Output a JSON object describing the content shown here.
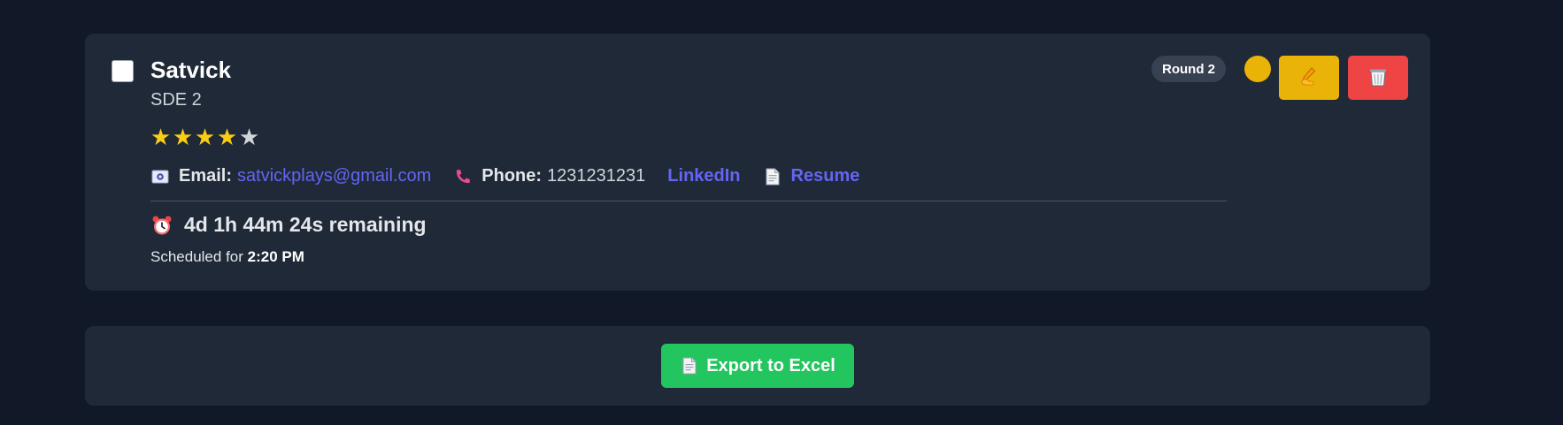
{
  "candidate": {
    "name": "Satvick",
    "role": "SDE 2",
    "rating": 4,
    "rating_max": 5,
    "email_label": "Email:",
    "email": "satvickplays@gmail.com",
    "phone_label": "Phone:",
    "phone": "1231231231",
    "linkedin_label": "LinkedIn",
    "resume_label": "Resume",
    "time_remaining": "4d 1h 44m 24s remaining",
    "scheduled_prefix": "Scheduled for",
    "scheduled_time": "2:20 PM",
    "round_badge": "Round 2",
    "status_color": "#eab308"
  },
  "icons": {
    "email": "email-envelope-icon",
    "phone": "phone-receiver-icon",
    "resume": "document-icon",
    "timer": "alarm-clock-icon",
    "edit": "writing-hand-icon",
    "delete": "wastebasket-icon",
    "export": "document-icon"
  },
  "colors": {
    "background": "#111827",
    "card": "#1f2937",
    "star_filled": "#facc15",
    "star_empty": "#d1d5db",
    "link": "#6366f1",
    "edit_button": "#eab308",
    "delete_button": "#ef4444",
    "export_button": "#22c55e"
  },
  "footer": {
    "export_label": "Export to Excel"
  }
}
